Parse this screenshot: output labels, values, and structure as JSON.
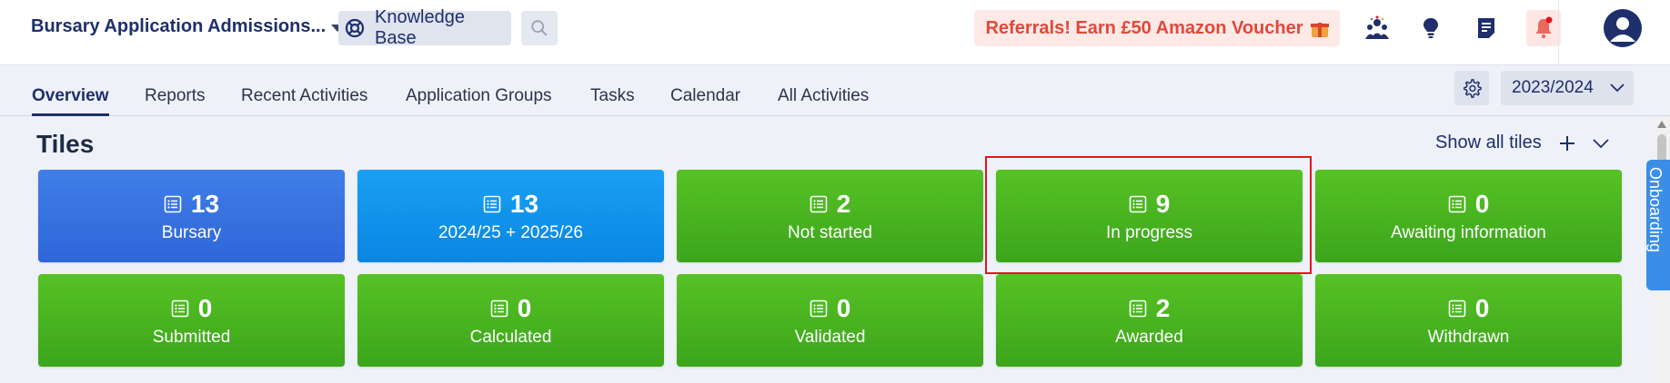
{
  "header": {
    "app_title": "Bursary Application Admissions...",
    "knowledge_base": "Knowledge Base",
    "referral": "Referrals! Earn £50 Amazon Voucher"
  },
  "tabs": [
    {
      "label": "Overview",
      "active": true
    },
    {
      "label": "Reports"
    },
    {
      "label": "Recent Activities"
    },
    {
      "label": "Application Groups"
    },
    {
      "label": "Tasks"
    },
    {
      "label": "Calendar"
    },
    {
      "label": "All Activities"
    }
  ],
  "year_selector": "2023/2024",
  "tiles_section": {
    "title": "Tiles",
    "show_all": "Show all tiles"
  },
  "tiles": [
    {
      "count": "13",
      "label": "Bursary",
      "color": "#3474e0"
    },
    {
      "count": "13",
      "label": "2024/25 + 2025/26",
      "color": "#1495ec"
    },
    {
      "count": "2",
      "label": "Not started",
      "color": "#4bb421"
    },
    {
      "count": "9",
      "label": "In progress",
      "color": "#4bb421"
    },
    {
      "count": "0",
      "label": "Awaiting information",
      "color": "#4bb421"
    },
    {
      "count": "0",
      "label": "Submitted",
      "color": "#4bb421"
    },
    {
      "count": "0",
      "label": "Calculated",
      "color": "#4bb421"
    },
    {
      "count": "0",
      "label": "Validated",
      "color": "#4bb421"
    },
    {
      "count": "2",
      "label": "Awarded",
      "color": "#4bb421"
    },
    {
      "count": "0",
      "label": "Withdrawn",
      "color": "#4bb421"
    }
  ],
  "onboarding": "Onboarding",
  "colors": {
    "brand": "#1e2f6b",
    "highlight": "#e2141d",
    "referral_text": "#e0493a"
  }
}
